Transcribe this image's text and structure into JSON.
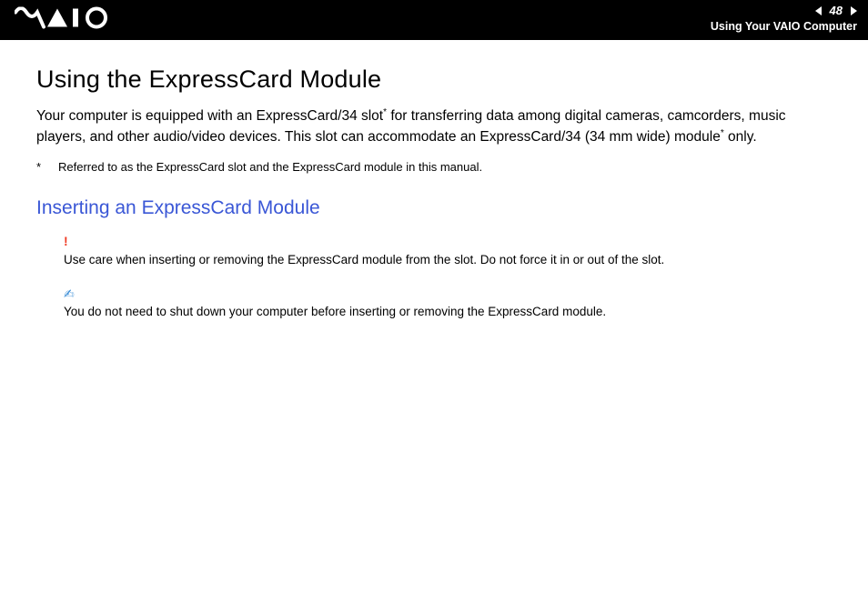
{
  "header": {
    "page_number": "48",
    "section": "Using Your VAIO Computer"
  },
  "main": {
    "title": "Using the ExpressCard Module",
    "intro_part1": "Your computer is equipped with an ExpressCard/34 slot",
    "intro_part2": " for transferring data among digital cameras, camcorders, music players, and other audio/video devices. This slot can accommodate an ExpressCard/34 (34 mm wide) module",
    "intro_part3": " only.",
    "asterisk": "*",
    "footnote": "Referred to as the ExpressCard slot and the ExpressCard module in this manual.",
    "subtitle": "Inserting an ExpressCard Module",
    "warn_mark": "!",
    "warn_text": "Use care when inserting or removing the ExpressCard module from the slot. Do not force it in or out of the slot.",
    "tip_mark": "✍︎",
    "tip_text": "You do not need to shut down your computer before inserting or removing the ExpressCard module."
  }
}
